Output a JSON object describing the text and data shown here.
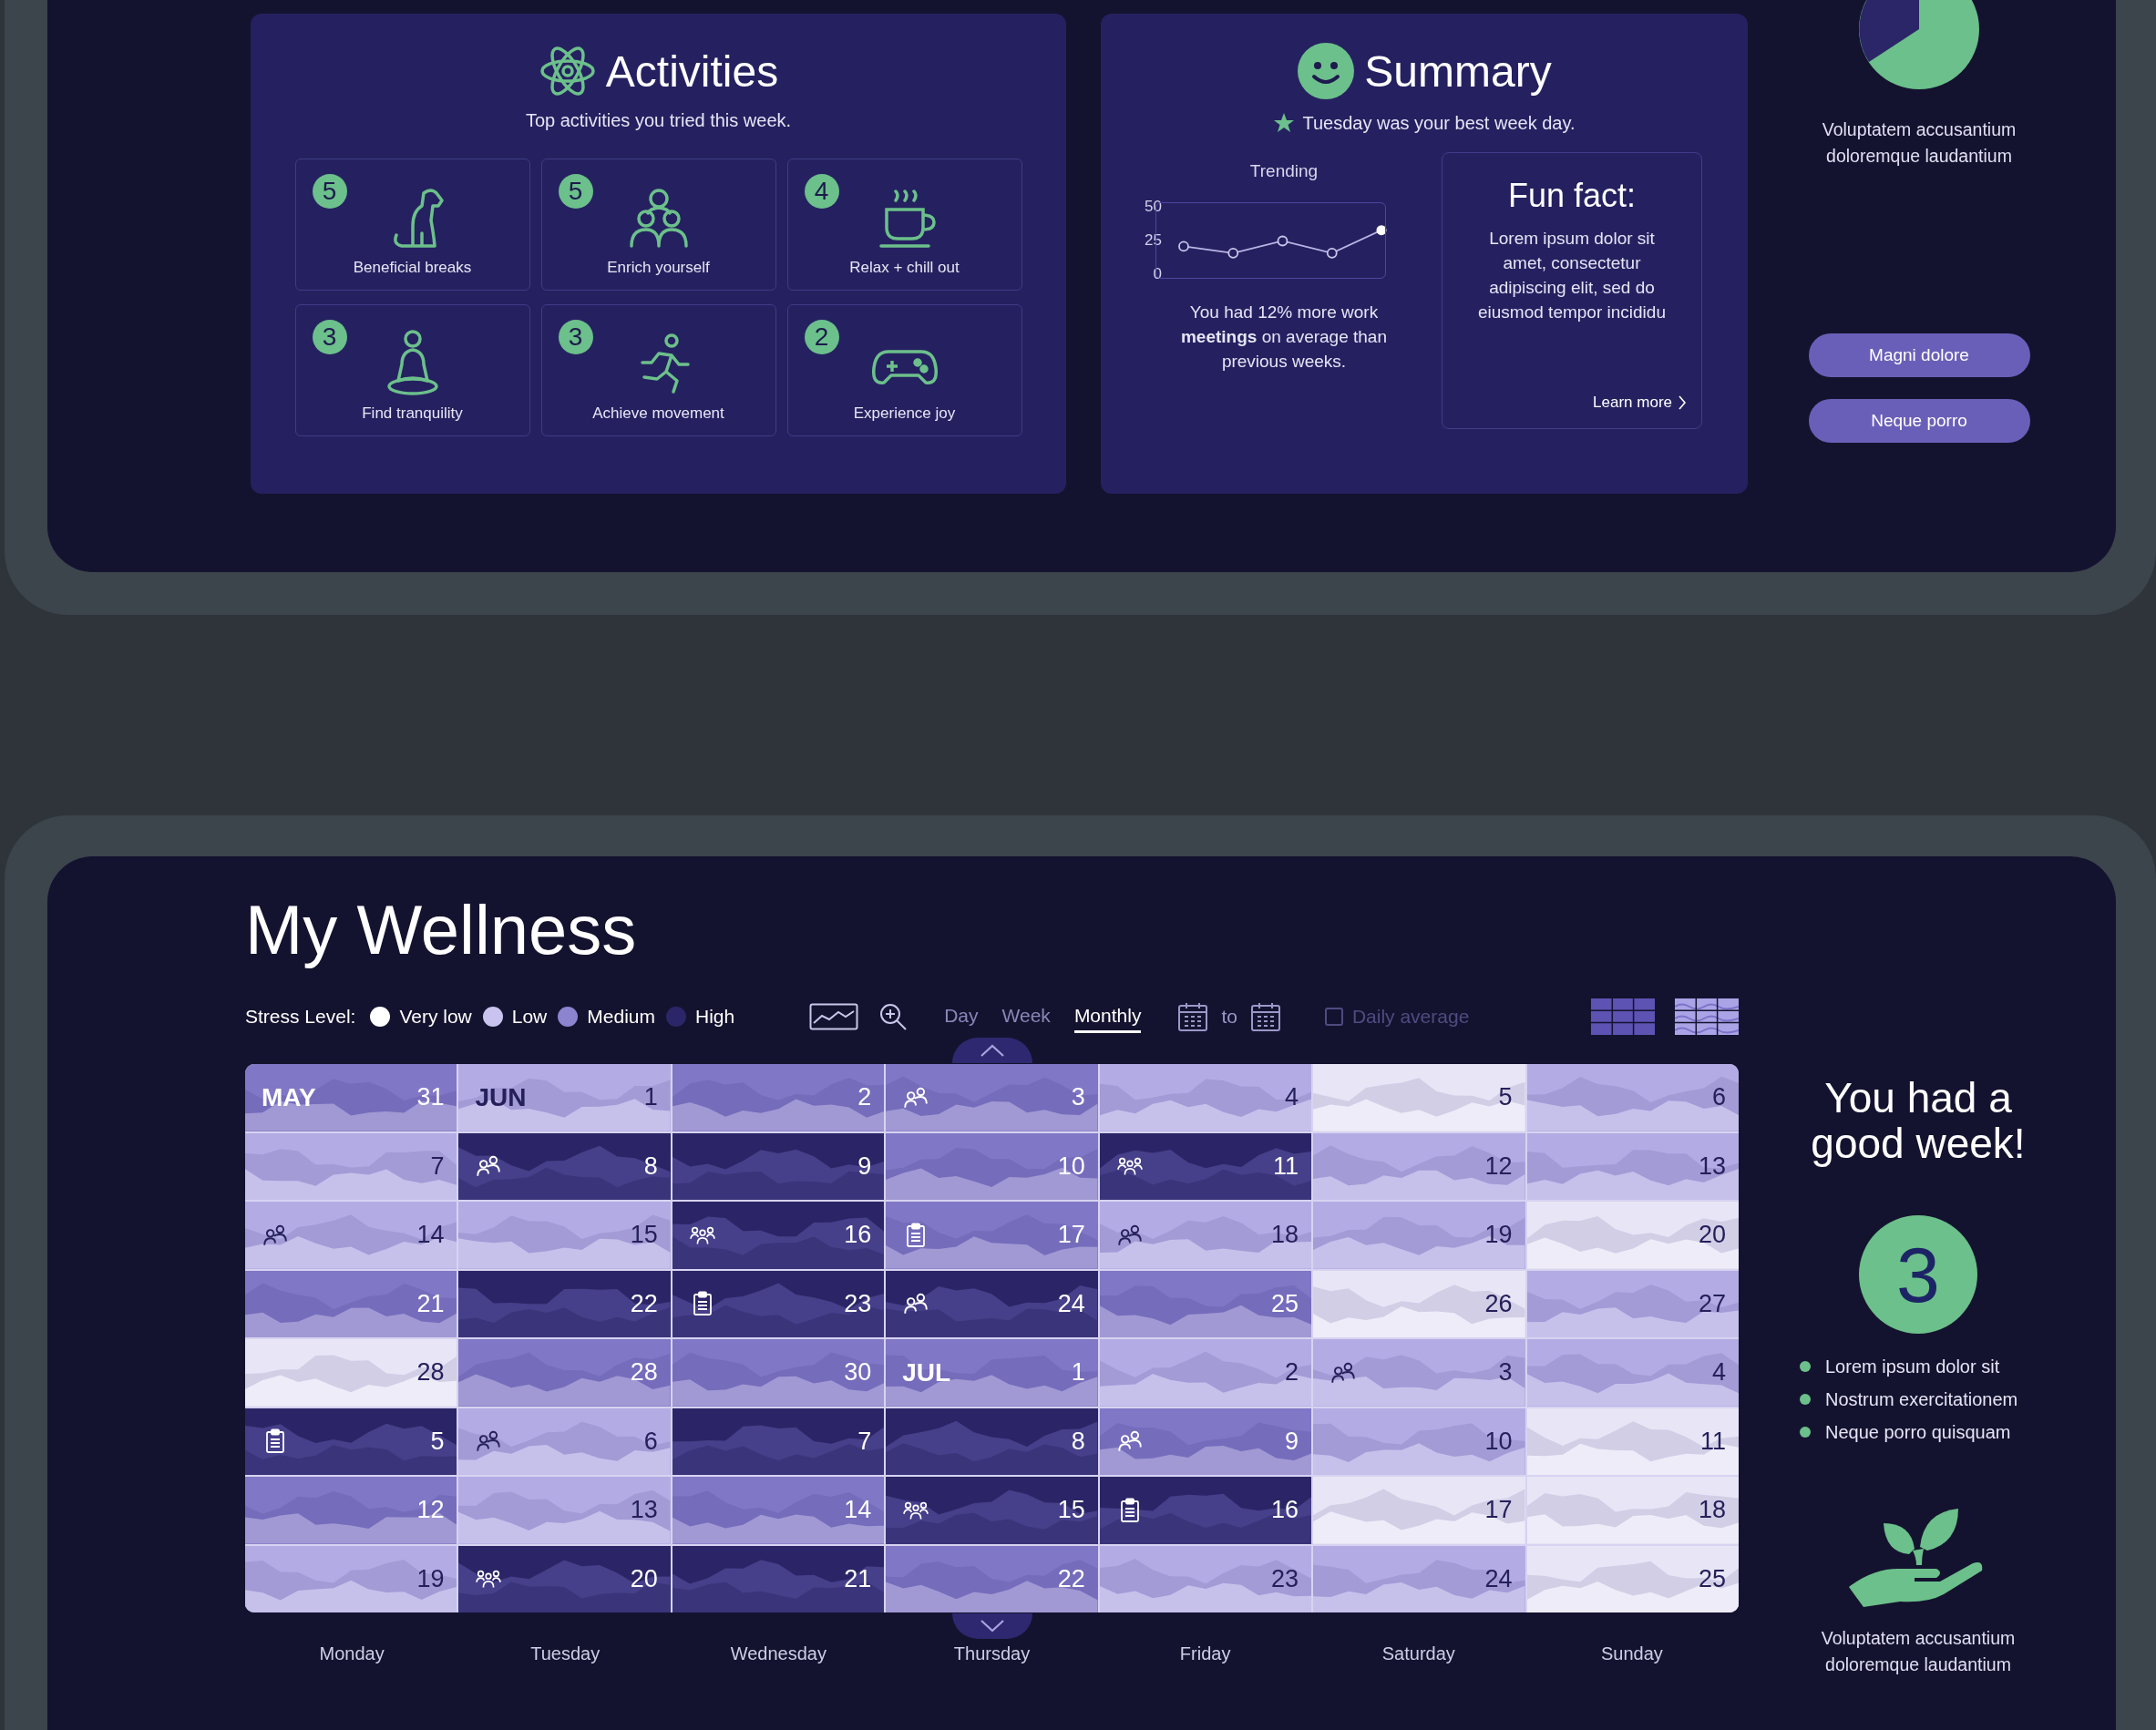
{
  "activities": {
    "title": "Activities",
    "subtitle": "Top activities you tried this week.",
    "items": [
      {
        "count": "5",
        "label": "Beneficial breaks",
        "kind": "dog"
      },
      {
        "count": "5",
        "label": "Enrich yourself",
        "kind": "people"
      },
      {
        "count": "4",
        "label": "Relax + chill out",
        "kind": "coffee"
      },
      {
        "count": "3",
        "label": "Find tranquility",
        "kind": "meditation"
      },
      {
        "count": "3",
        "label": "Achieve movement",
        "kind": "running"
      },
      {
        "count": "2",
        "label": "Experience joy",
        "kind": "gamepad"
      }
    ]
  },
  "summary": {
    "title": "Summary",
    "best_day": "Tuesday was your best week day.",
    "trend": {
      "chart_data": {
        "type": "line",
        "title": "Trending",
        "categories": [
          null,
          null,
          null,
          null,
          null
        ],
        "series": [
          {
            "color": "#b9b5e6",
            "values": [
              20,
              15,
              24,
              15,
              32
            ]
          }
        ],
        "ylim": [
          0,
          50
        ],
        "yticks": [
          0,
          25,
          50
        ]
      },
      "caption": "You had 12% more work **meetings** on average than previous weeks."
    },
    "fun_fact": {
      "title": "Fun fact:",
      "body": "Lorem ipsum dolor sit amet, consectetur adipiscing elit, sed do eiusmod tempor incididu",
      "link": "Learn more"
    }
  },
  "side_top": {
    "caption": "Voluptatem accusantium doloremque laudantium",
    "buttons": [
      "Magni dolore",
      "Neque porro"
    ]
  },
  "wellness": {
    "title": "My Wellness",
    "legend": {
      "label": "Stress Level:",
      "items": [
        {
          "label": "Very low",
          "color": "#ffffff"
        },
        {
          "label": "Low",
          "color": "#c9c4ef"
        },
        {
          "label": "Medium",
          "color": "#8d84d0"
        },
        {
          "label": "High",
          "color": "#2b2668"
        }
      ]
    },
    "view_tabs": [
      {
        "label": "Day",
        "selected": false
      },
      {
        "label": "Week",
        "selected": false
      },
      {
        "label": "Monthly",
        "selected": true
      }
    ],
    "range": {
      "separator": "to"
    },
    "daily_average": {
      "label": "Daily average",
      "checked": false,
      "disabled": true
    },
    "layouts": [
      {
        "kind": "grid",
        "selected": false
      },
      {
        "kind": "waves",
        "selected": true
      }
    ],
    "weeks": [
      [
        {
          "month": "MAY",
          "day": "31",
          "color": "#8077c6"
        },
        {
          "month": "JUN",
          "day": "1",
          "color": "#b3ace4"
        },
        {
          "day": "2",
          "color": "#8077c6"
        },
        {
          "day": "3",
          "color": "#8077c6",
          "kind": "pair"
        },
        {
          "day": "4",
          "color": "#b3ace4"
        },
        {
          "day": "5",
          "color": "#e8e6f6"
        },
        {
          "day": "6",
          "color": "#b3ace4"
        }
      ],
      [
        {
          "day": "7",
          "color": "#b3ace4"
        },
        {
          "day": "8",
          "color": "#2b2567",
          "kind": "pair"
        },
        {
          "day": "9",
          "color": "#2b2567"
        },
        {
          "day": "10",
          "color": "#8077c6"
        },
        {
          "day": "11",
          "color": "#2b2567",
          "kind": "group"
        },
        {
          "day": "12",
          "color": "#b3ace4"
        },
        {
          "day": "13",
          "color": "#b3ace4"
        }
      ],
      [
        {
          "day": "14",
          "color": "#b3ace4",
          "kind": "pair"
        },
        {
          "day": "15",
          "color": "#b3ace4"
        },
        {
          "day": "16",
          "color": "#2b2567",
          "kind": "group"
        },
        {
          "day": "17",
          "color": "#8077c6",
          "kind": "note"
        },
        {
          "day": "18",
          "color": "#b3ace4",
          "kind": "pair"
        },
        {
          "day": "19",
          "color": "#b3ace4"
        },
        {
          "day": "20",
          "color": "#e8e6f6"
        }
      ],
      [
        {
          "day": "21",
          "color": "#8077c6"
        },
        {
          "day": "22",
          "color": "#2b2567"
        },
        {
          "day": "23",
          "color": "#2b2567",
          "kind": "note"
        },
        {
          "day": "24",
          "color": "#2b2567",
          "kind": "pair"
        },
        {
          "day": "25",
          "color": "#8077c6"
        },
        {
          "day": "26",
          "color": "#e8e6f6"
        },
        {
          "day": "27",
          "color": "#b3ace4"
        }
      ],
      [
        {
          "day": "28",
          "color": "#e8e6f6"
        },
        {
          "day": "28",
          "color": "#8077c6"
        },
        {
          "day": "30",
          "color": "#8077c6"
        },
        {
          "month": "JUL",
          "day": "1",
          "color": "#8077c6"
        },
        {
          "day": "2",
          "color": "#b3ace4"
        },
        {
          "day": "3",
          "color": "#b3ace4",
          "kind": "pair"
        },
        {
          "day": "4",
          "color": "#b3ace4"
        }
      ],
      [
        {
          "day": "5",
          "color": "#2b2567",
          "kind": "note"
        },
        {
          "day": "6",
          "color": "#b3ace4",
          "kind": "pair"
        },
        {
          "day": "7",
          "color": "#2b2567"
        },
        {
          "day": "8",
          "color": "#2b2567"
        },
        {
          "day": "9",
          "color": "#8077c6",
          "kind": "pair"
        },
        {
          "day": "10",
          "color": "#b3ace4"
        },
        {
          "day": "11",
          "color": "#e8e6f6"
        }
      ],
      [
        {
          "day": "12",
          "color": "#8077c6"
        },
        {
          "day": "13",
          "color": "#b3ace4"
        },
        {
          "day": "14",
          "color": "#8077c6"
        },
        {
          "day": "15",
          "color": "#2b2567",
          "kind": "group"
        },
        {
          "day": "16",
          "color": "#2b2567",
          "kind": "note"
        },
        {
          "day": "17",
          "color": "#e8e6f6"
        },
        {
          "day": "18",
          "color": "#e8e6f6"
        }
      ],
      [
        {
          "day": "19",
          "color": "#b3ace4"
        },
        {
          "day": "20",
          "color": "#2b2567",
          "kind": "group"
        },
        {
          "day": "21",
          "color": "#2b2567"
        },
        {
          "day": "22",
          "color": "#8077c6"
        },
        {
          "day": "23",
          "color": "#b3ace4"
        },
        {
          "day": "24",
          "color": "#b3ace4"
        },
        {
          "day": "25",
          "color": "#e8e6f6"
        }
      ]
    ],
    "weekdays": [
      "Monday",
      "Tuesday",
      "Wednesday",
      "Thursday",
      "Friday",
      "Saturday",
      "Sunday"
    ]
  },
  "side_bottom": {
    "headline": "You had a good week!",
    "score": "3",
    "bullets": [
      "Lorem ipsum dolor sit",
      "Nostrum exercitationem",
      "Neque porro quisquam"
    ],
    "caption": "Voluptatem accusantium doloremque laudantium"
  }
}
